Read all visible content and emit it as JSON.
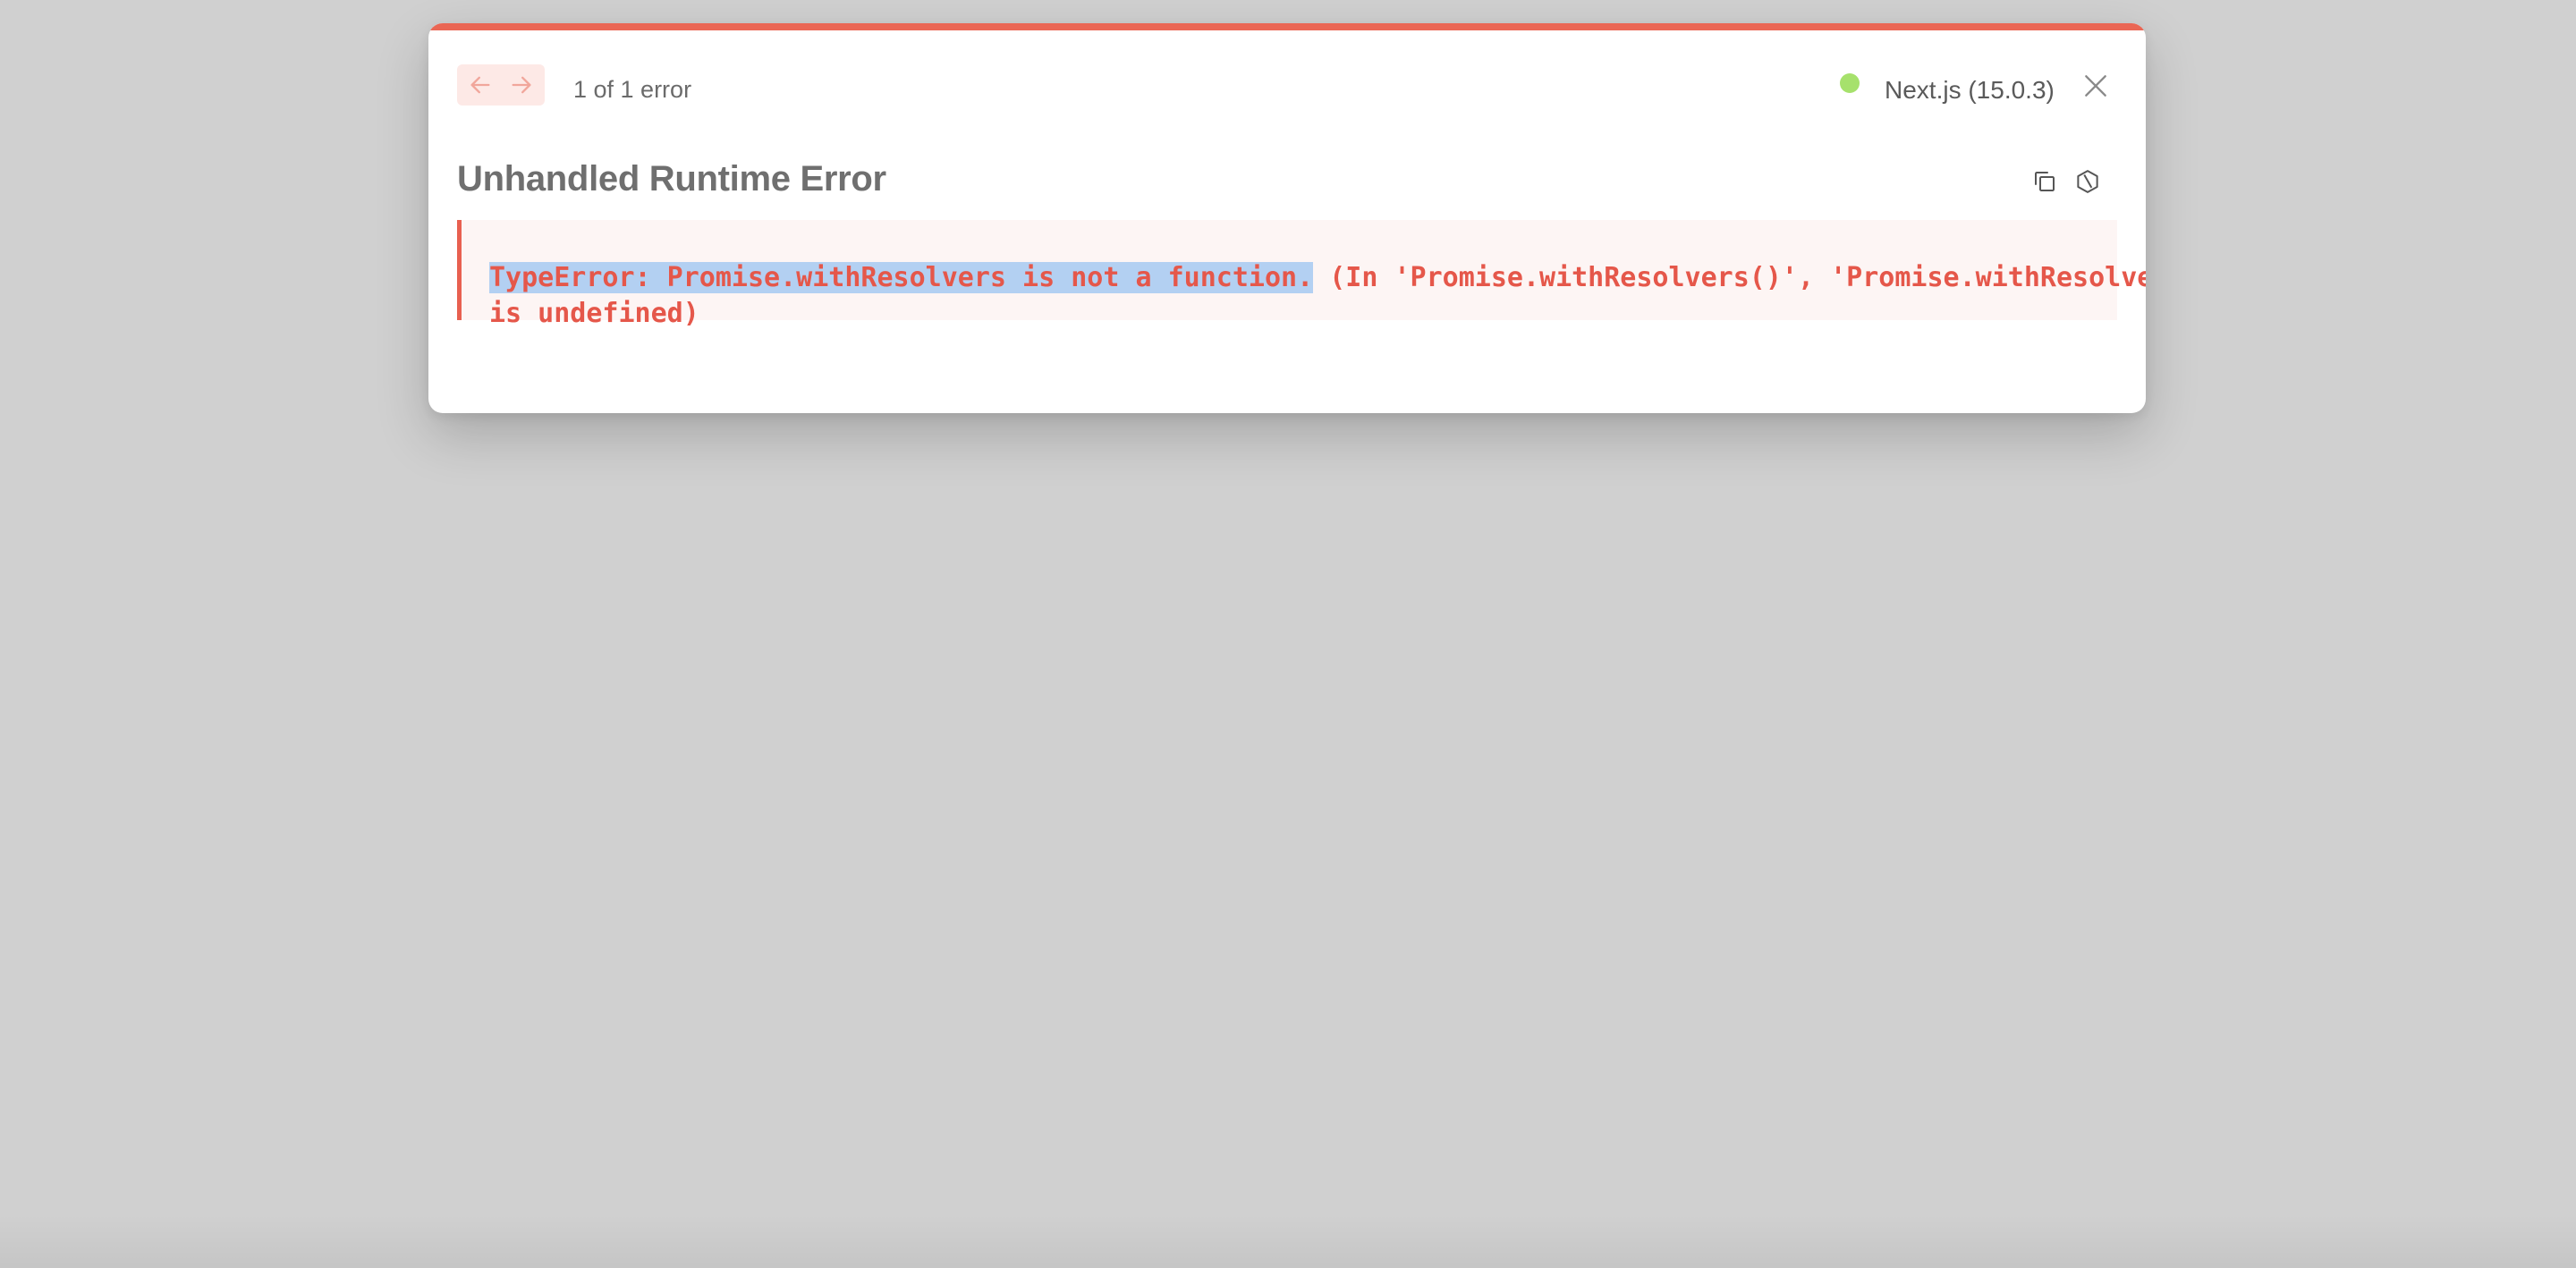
{
  "overlay": {
    "error_count_label": "1 of 1 error",
    "status_color": "#a6e16c",
    "accent_color": "#ea6654",
    "version_label": "Next.js (15.0.3)",
    "title": "Unhandled Runtime Error",
    "error": {
      "line1_selected": "TypeError: Promise.withResolvers is not a function.",
      "line1_rest": " (In 'Promise.withResolvers()', 'Promise.withResolvers'",
      "line2": "is undefined)"
    },
    "icons": {
      "prev": "arrow-left-icon",
      "next": "arrow-right-icon",
      "close": "close-icon",
      "copy": "copy-icon",
      "docs": "hexagon-icon"
    }
  }
}
